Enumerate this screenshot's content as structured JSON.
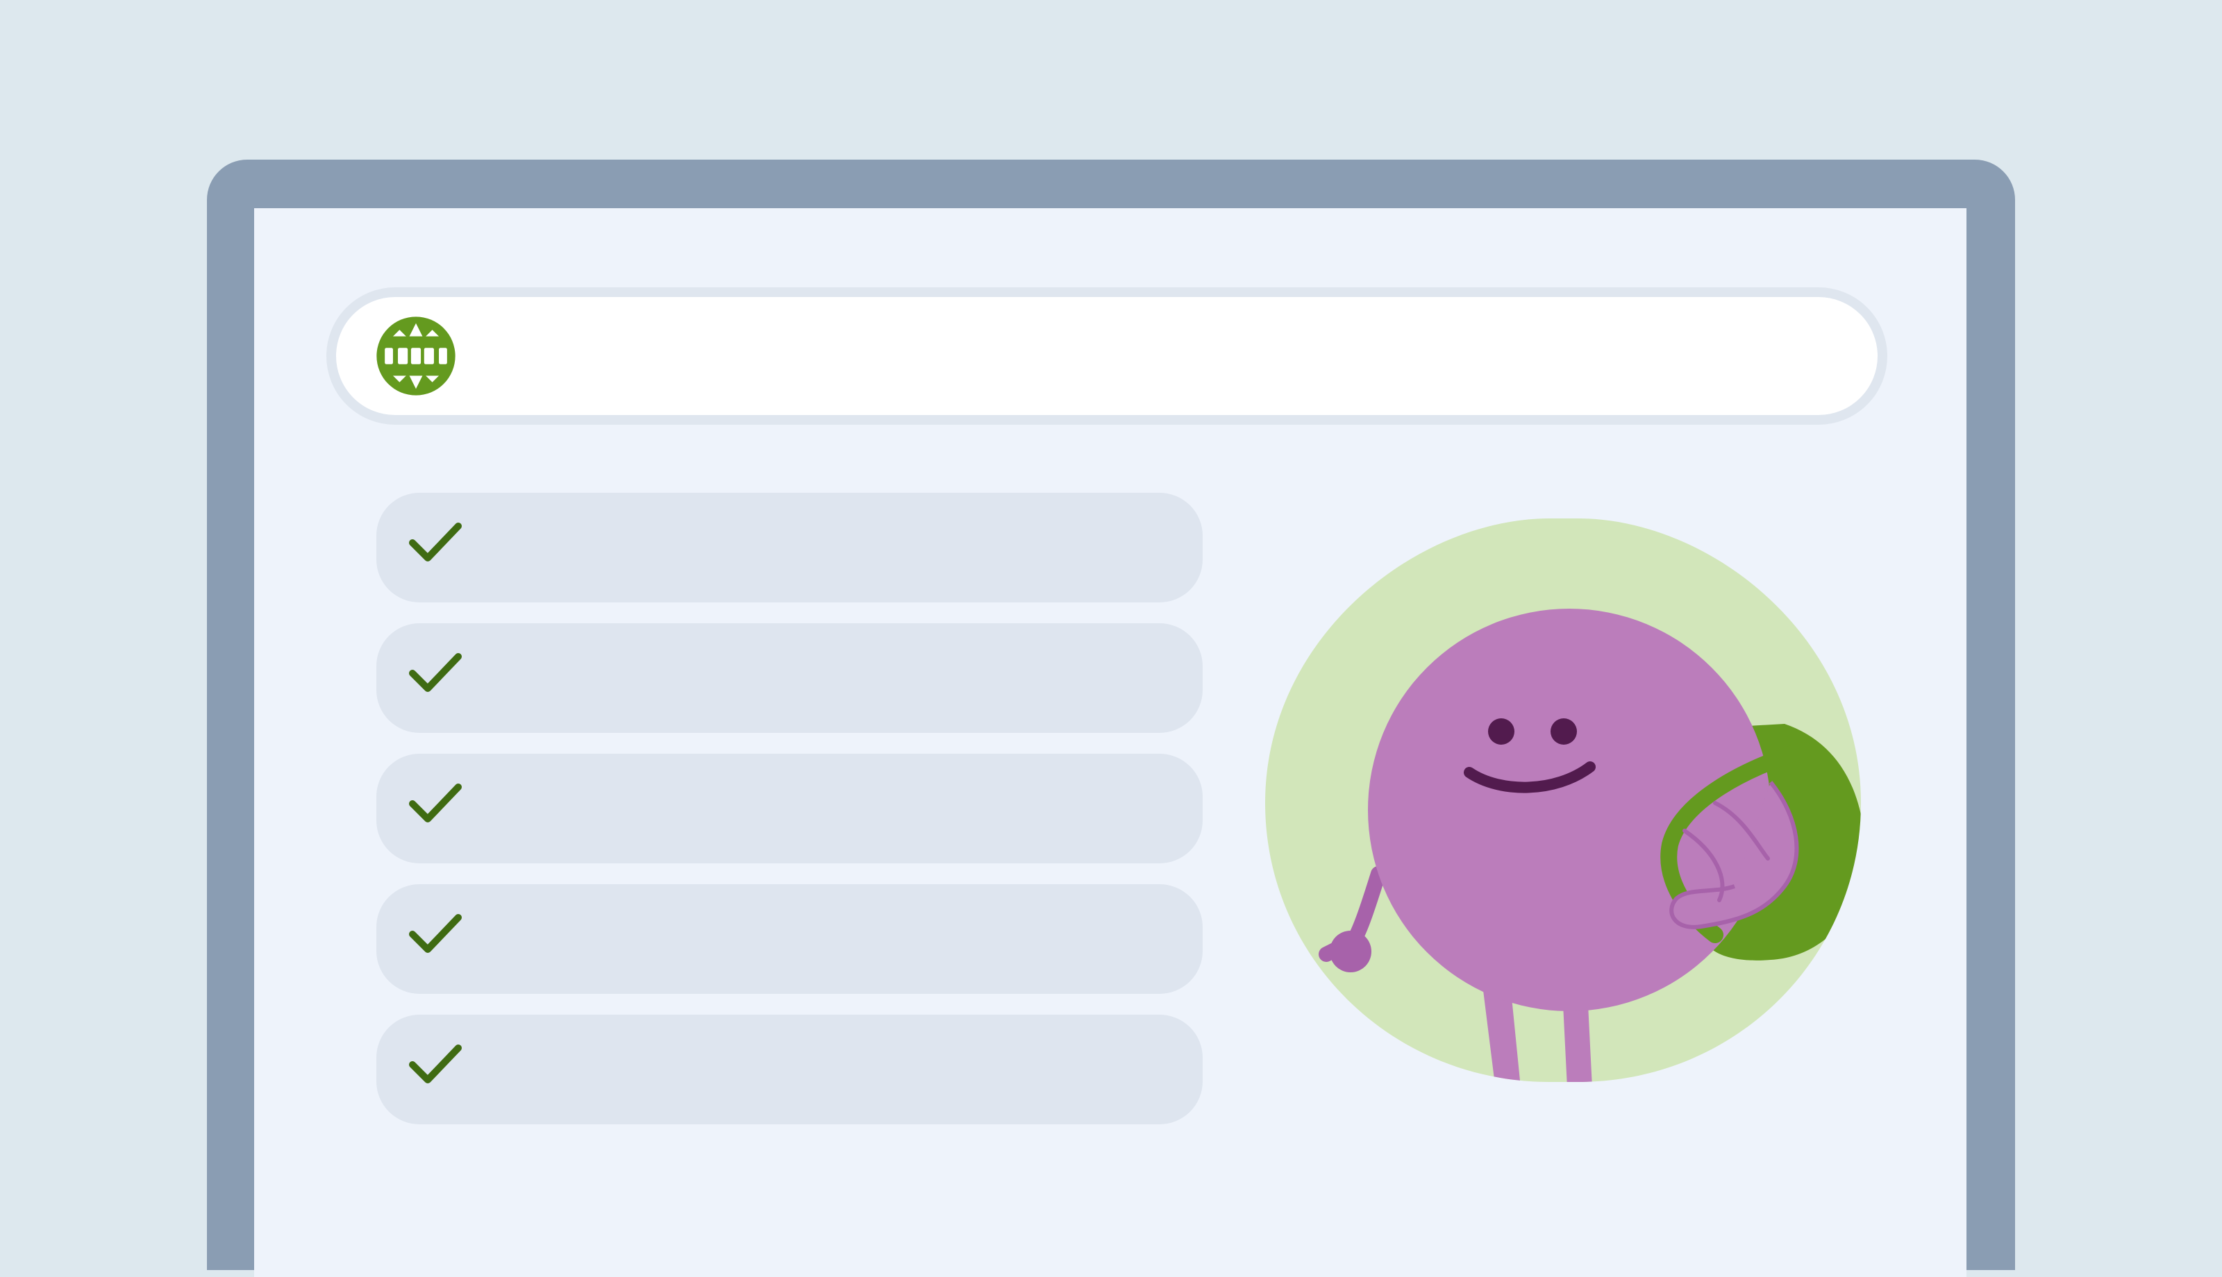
{
  "window": {
    "frame_color": "#8a9db3",
    "screen_color": "#eef3fb"
  },
  "address_bar": {
    "icon": "globe-icon",
    "icon_color": "#649a1f",
    "url_text": ""
  },
  "checklist": {
    "icon": "check-icon",
    "icon_color": "#3f6b12",
    "items": [
      {
        "label": ""
      },
      {
        "label": ""
      },
      {
        "label": ""
      },
      {
        "label": ""
      },
      {
        "label": ""
      }
    ]
  },
  "illustration": {
    "subject": "purple-mascot-with-green-backpack",
    "badge_color": "#d2e6ba",
    "body_color": "#bb7dbb",
    "backpack_color": "#649a1f"
  }
}
